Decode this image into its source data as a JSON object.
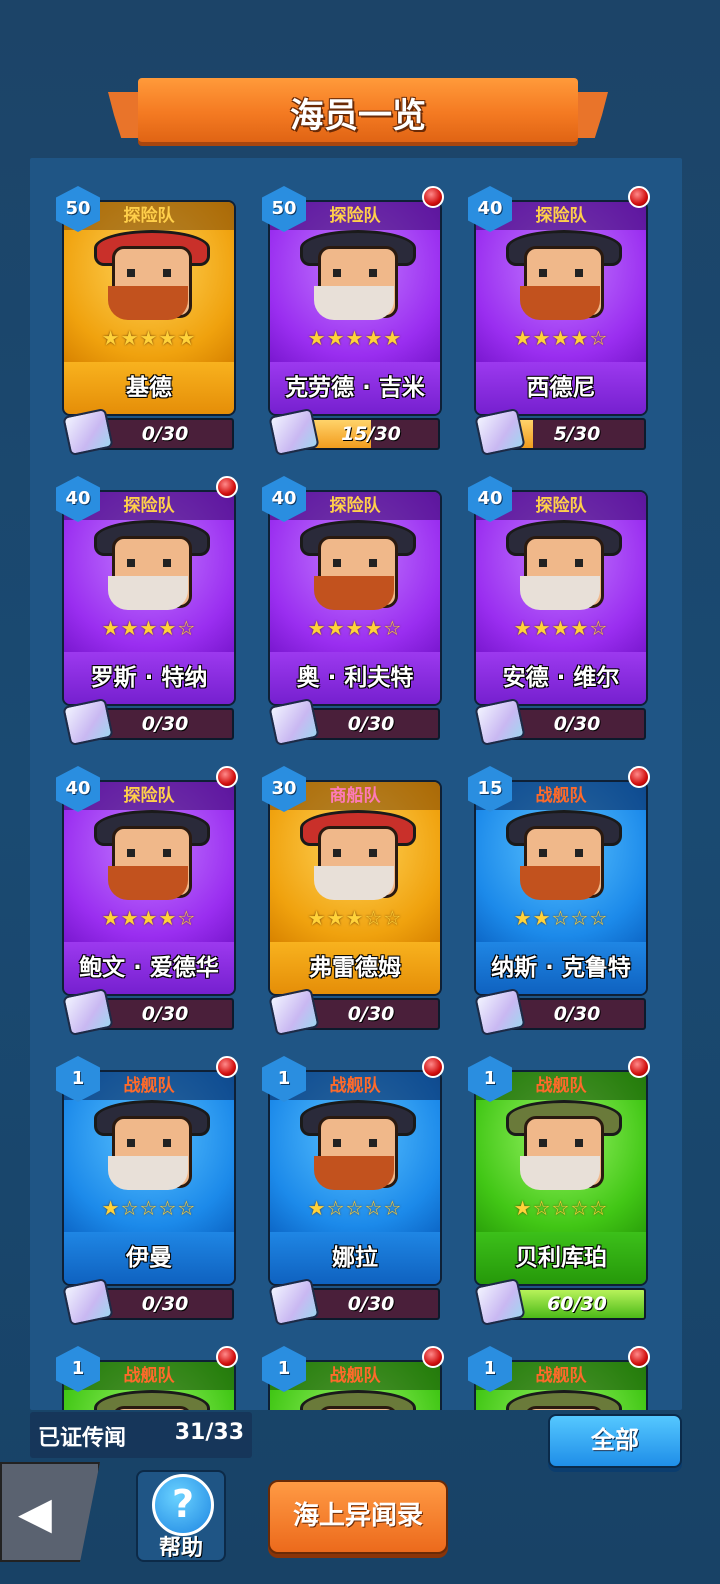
{
  "title": "海员一览",
  "crew": [
    {
      "level": "50",
      "tier": "探险队",
      "tier_class": "tier-explore",
      "name": "基德",
      "stars": "★★★★★",
      "progress": "0/30",
      "fill": 0,
      "color": "yellow",
      "new": false
    },
    {
      "level": "50",
      "tier": "探险队",
      "tier_class": "tier-explore",
      "name": "克劳德 · 吉米",
      "stars": "★★★★★",
      "progress": "15/30",
      "fill": 0.5,
      "color": "purple",
      "new": true
    },
    {
      "level": "40",
      "tier": "探险队",
      "tier_class": "tier-explore",
      "name": "西德尼",
      "stars": "★★★★☆",
      "progress": "5/30",
      "fill": 0.17,
      "color": "purple",
      "new": true
    },
    {
      "level": "40",
      "tier": "探险队",
      "tier_class": "tier-explore",
      "name": "罗斯 · 特纳",
      "stars": "★★★★☆",
      "progress": "0/30",
      "fill": 0,
      "color": "purple",
      "new": true
    },
    {
      "level": "40",
      "tier": "探险队",
      "tier_class": "tier-explore",
      "name": "奥 · 利夫特",
      "stars": "★★★★☆",
      "progress": "0/30",
      "fill": 0,
      "color": "purple",
      "new": false
    },
    {
      "level": "40",
      "tier": "探险队",
      "tier_class": "tier-explore",
      "name": "安德 · 维尔",
      "stars": "★★★★☆",
      "progress": "0/30",
      "fill": 0,
      "color": "purple",
      "new": false
    },
    {
      "level": "40",
      "tier": "探险队",
      "tier_class": "tier-explore",
      "name": "鲍文 · 爱德华",
      "stars": "★★★★☆",
      "progress": "0/30",
      "fill": 0,
      "color": "purple",
      "new": true
    },
    {
      "level": "30",
      "tier": "商船队",
      "tier_class": "tier-merchant",
      "name": "弗雷德姆",
      "stars": "★★★☆☆",
      "progress": "0/30",
      "fill": 0,
      "color": "yellow",
      "new": false
    },
    {
      "level": "15",
      "tier": "战舰队",
      "tier_class": "tier-war",
      "name": "纳斯 · 克鲁特",
      "stars": "★★☆☆☆",
      "progress": "0/30",
      "fill": 0,
      "color": "blue",
      "new": true
    },
    {
      "level": "1",
      "tier": "战舰队",
      "tier_class": "tier-war",
      "name": "伊曼",
      "stars": "★☆☆☆☆",
      "progress": "0/30",
      "fill": 0,
      "color": "blue",
      "new": true
    },
    {
      "level": "1",
      "tier": "战舰队",
      "tier_class": "tier-war",
      "name": "娜拉",
      "stars": "★☆☆☆☆",
      "progress": "0/30",
      "fill": 0,
      "color": "blue",
      "new": true
    },
    {
      "level": "1",
      "tier": "战舰队",
      "tier_class": "tier-war",
      "name": "贝利库珀",
      "stars": "★☆☆☆☆",
      "progress": "60/30",
      "fill": 1,
      "color": "green",
      "new": true
    },
    {
      "level": "1",
      "tier": "战舰队",
      "tier_class": "tier-war",
      "name": "",
      "stars": "",
      "progress": "",
      "fill": 0,
      "color": "green",
      "new": true
    },
    {
      "level": "1",
      "tier": "战舰队",
      "tier_class": "tier-war",
      "name": "",
      "stars": "",
      "progress": "",
      "fill": 0,
      "color": "green",
      "new": true
    },
    {
      "level": "1",
      "tier": "战舰队",
      "tier_class": "tier-war",
      "name": "",
      "stars": "",
      "progress": "",
      "fill": 0,
      "color": "green",
      "new": true
    }
  ],
  "footer": {
    "collected_label": "已证传闻",
    "collected_value": "31/33",
    "filter_label": "全部",
    "help_label": "帮助",
    "help_icon": "?",
    "back_icon": "◀",
    "log_label": "海上异闻录"
  }
}
